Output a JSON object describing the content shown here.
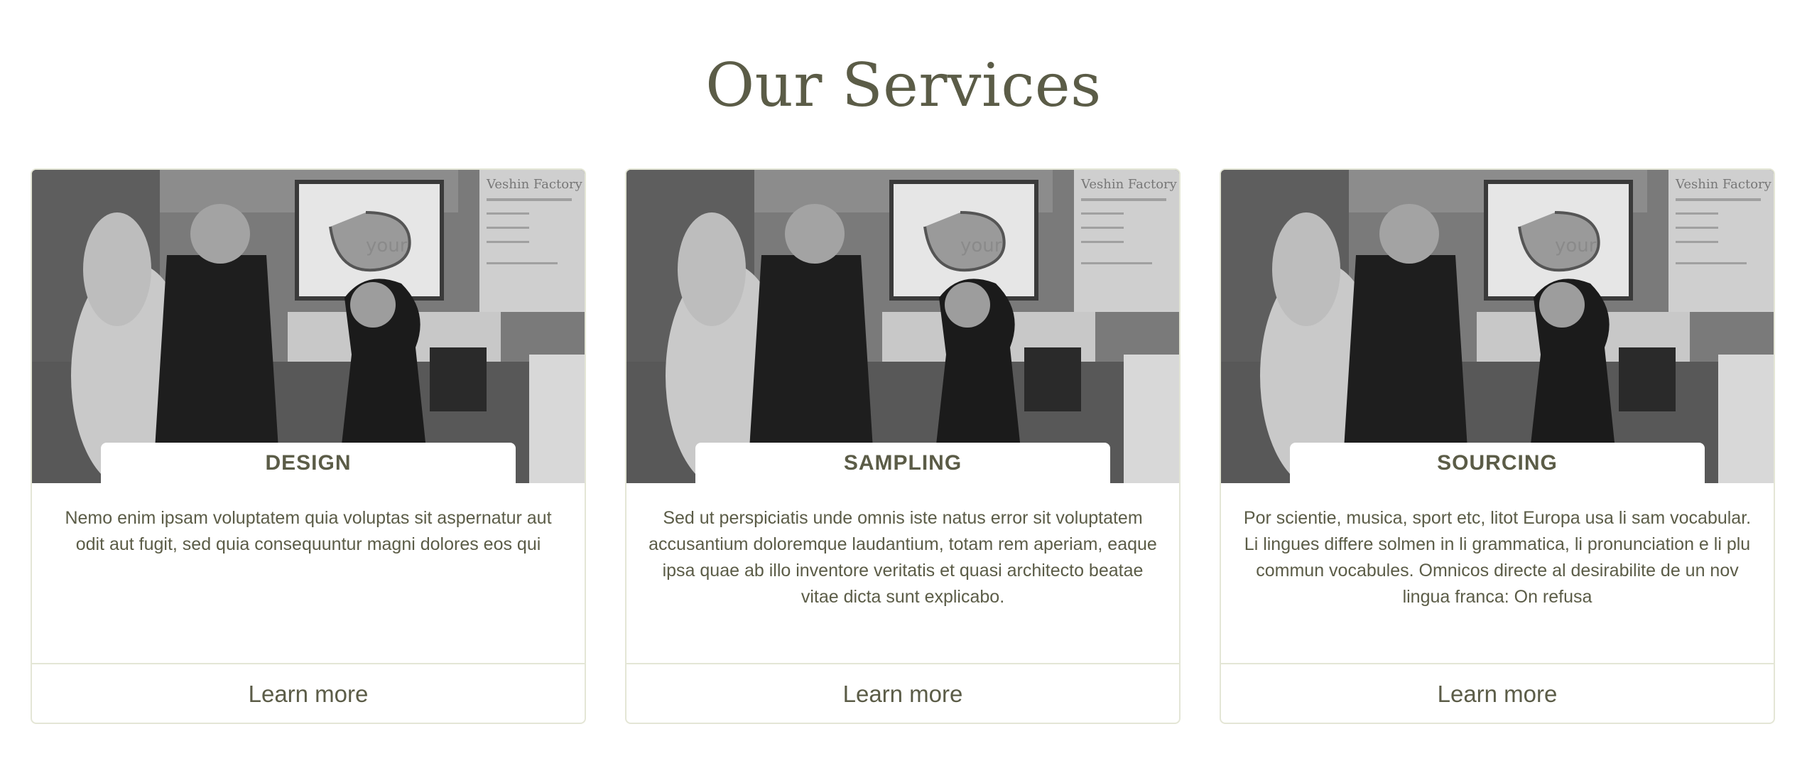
{
  "section": {
    "title": "Our Services"
  },
  "services": [
    {
      "label": "DESIGN",
      "description": "Nemo enim ipsam voluptatem quia voluptas sit aspernatur aut odit aut fugit, sed quia consequuntur magni dolores eos qui",
      "link_label": "Learn more"
    },
    {
      "label": "SAMPLING",
      "description": "Sed ut perspiciatis unde omnis iste natus error sit voluptatem accusantium doloremque laudantium, totam rem aperiam, eaque ipsa quae ab illo inventore veritatis et quasi architecto beatae vitae dicta sunt explicabo.",
      "link_label": "Learn more"
    },
    {
      "label": "SOURCING",
      "description": "Por scientie, musica, sport etc, litot Europa usa li sam vocabular. Li lingues differe solmen in li grammatica, li pronunciation e li plu commun vocabules. Omnicos directe al desirabilite de un nov lingua franca: On refusa",
      "link_label": "Learn more"
    }
  ],
  "photo": {
    "poster_title": "Veshin Factory",
    "screen_text": "your"
  },
  "colors": {
    "text": "#5b5c47",
    "border": "#e4e6d6",
    "background": "#ffffff"
  }
}
